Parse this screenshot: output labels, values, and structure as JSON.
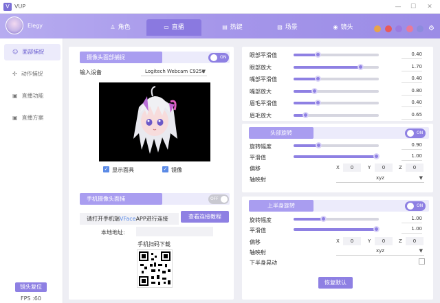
{
  "app": {
    "title": "VUP",
    "logo_letter": "V"
  },
  "header": {
    "username": "Elegy",
    "tabs": [
      {
        "label": "角色",
        "icon": "person-icon"
      },
      {
        "label": "直播",
        "icon": "broadcast-icon"
      },
      {
        "label": "热键",
        "icon": "keyboard-icon"
      },
      {
        "label": "场景",
        "icon": "image-icon"
      },
      {
        "label": "镜头",
        "icon": "camera-icon"
      }
    ],
    "active_tab": "直播",
    "action_icons": [
      {
        "name": "record-icon",
        "color": "#e8a44a"
      },
      {
        "name": "record2-icon",
        "color": "#e85a5a"
      },
      {
        "name": "chat-icon",
        "color": "#9b7be0"
      },
      {
        "name": "user-icon",
        "color": "#e87a9a"
      },
      {
        "name": "vip-icon",
        "color": "#8c8cde"
      }
    ]
  },
  "sidebar": {
    "items": [
      {
        "label": "面部捕捉",
        "icon": "face-icon"
      },
      {
        "label": "动作捕捉",
        "icon": "motion-icon"
      },
      {
        "label": "直播功能",
        "icon": "live-icon"
      },
      {
        "label": "直播方案",
        "icon": "plan-icon"
      }
    ],
    "reset_label": "镜头复位",
    "fps": "FPS :60"
  },
  "face_capture": {
    "title": "摄像头面部捕捉",
    "toggle": "ON",
    "input_label": "输入设备",
    "device": "Logitech Webcam C925e",
    "show_mask": "显示面具",
    "mirror": "镜像"
  },
  "phone_capture": {
    "title": "手机摄像头面捕",
    "toggle": "OFF",
    "instruction_pre": "请打开手机端",
    "instruction_app": "VFace",
    "instruction_post": "APP进行连接",
    "tutorial_button": "查看连接教程",
    "address_label": "本地地址:",
    "qr_label": "手机扫码下载"
  },
  "face_params": [
    {
      "label": "眼部平滑值",
      "value": "0.40",
      "fraction": 0.28
    },
    {
      "label": "眼部放大",
      "value": "1.70",
      "fraction": 0.78
    },
    {
      "label": "嘴部平滑值",
      "value": "0.40",
      "fraction": 0.28
    },
    {
      "label": "嘴部放大",
      "value": "0.80",
      "fraction": 0.24
    },
    {
      "label": "眉毛平滑值",
      "value": "0.40",
      "fraction": 0.28
    },
    {
      "label": "眉毛放大",
      "value": "0.65",
      "fraction": 0.14
    }
  ],
  "head_rotation": {
    "title": "头部旋转",
    "toggle": "ON",
    "amplitude_label": "旋转幅度",
    "amplitude_value": "0.90",
    "amplitude_fraction": 0.29,
    "smooth_label": "平滑值",
    "smooth_value": "1.00",
    "smooth_fraction": 0.97,
    "offset_label": "偏移",
    "x_label": "X",
    "x_value": "0",
    "y_label": "Y",
    "y_value": "0",
    "z_label": "Z",
    "z_value": "0",
    "axis_label": "轴映射",
    "axis_value": "xyz"
  },
  "upper_body": {
    "title": "上半身旋转",
    "toggle": "ON",
    "amplitude_label": "旋转幅度",
    "amplitude_value": "1.00",
    "amplitude_fraction": 0.35,
    "smooth_label": "平滑值",
    "smooth_value": "1.00",
    "smooth_fraction": 0.97,
    "offset_label": "偏移",
    "x_label": "X",
    "x_value": "0",
    "y_label": "Y",
    "y_value": "0",
    "z_label": "Z",
    "z_value": "0",
    "axis_label": "轴映射",
    "axis_value": "xyz",
    "sway_label": "下半身晃动",
    "restore_button": "恢复默认"
  }
}
